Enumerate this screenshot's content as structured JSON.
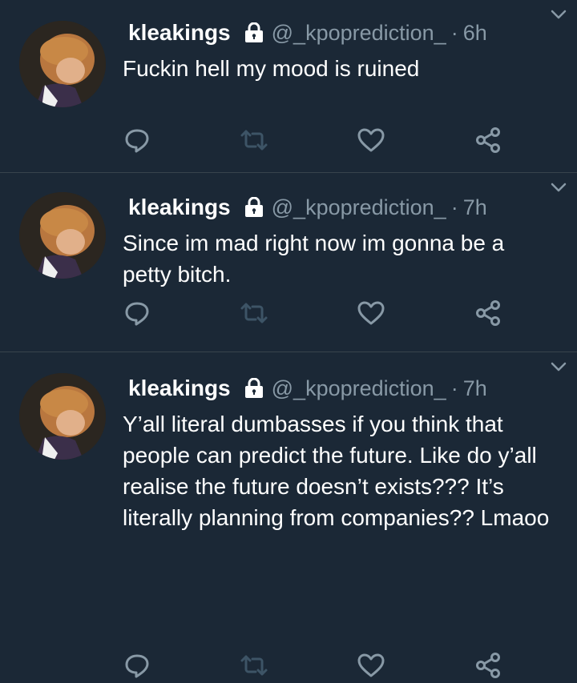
{
  "colors": {
    "background": "#1b2836",
    "divider": "#38444d",
    "text_primary": "#ffffff",
    "text_secondary": "#8899a6"
  },
  "icons": {
    "lock": "lock-icon",
    "more": "chevron-down-icon",
    "reply": "reply-icon",
    "retweet": "retweet-icon",
    "like": "heart-icon",
    "share": "share-icon"
  },
  "tweets": [
    {
      "name": "kleakings",
      "handle": "@_kpoprediction_",
      "separator": "·",
      "time": "6h",
      "text": "Fuckin hell my mood is ruined"
    },
    {
      "name": "kleakings",
      "handle": "@_kpoprediction_",
      "separator": "·",
      "time": "7h",
      "text": "Since im mad right now im gonna be a petty bitch."
    },
    {
      "name": "kleakings",
      "handle": "@_kpoprediction_",
      "separator": "·",
      "time": "7h",
      "text": "Y’all literal dumbasses if you think that people can predict the future. Like do y’all realise the future doesn’t exists??? It’s literally planning from companies?? Lmaoo"
    }
  ]
}
